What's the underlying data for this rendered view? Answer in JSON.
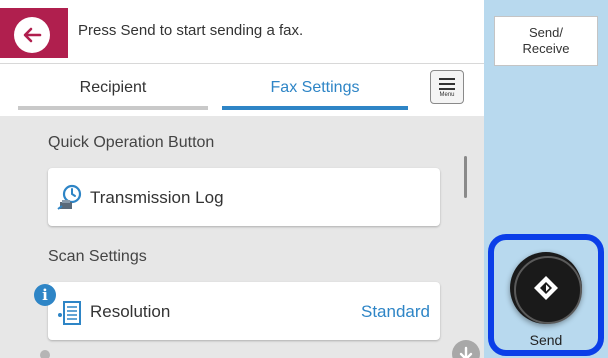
{
  "header": {
    "message": "Press Send to start sending a fax."
  },
  "tabs": [
    {
      "label": "Recipient",
      "active": false
    },
    {
      "label": "Fax Settings",
      "active": true
    }
  ],
  "menu_button": {
    "label": "Menu"
  },
  "sections": {
    "quick_operation": {
      "label": "Quick Operation Button",
      "items": [
        {
          "label": "Transmission Log",
          "icon": "transmission-log-icon"
        }
      ]
    },
    "scan_settings": {
      "label": "Scan Settings",
      "items": [
        {
          "label": "Resolution",
          "value": "Standard",
          "icon": "resolution-icon"
        }
      ]
    }
  },
  "side_panel": {
    "send_receive_line1": "Send/",
    "send_receive_line2": "Receive",
    "send_label": "Send"
  },
  "colors": {
    "accent": "#2e85c6",
    "back_tab": "#b01f4e",
    "side_panel": "#b8d9ee",
    "highlight_frame": "#0b3ee8"
  }
}
